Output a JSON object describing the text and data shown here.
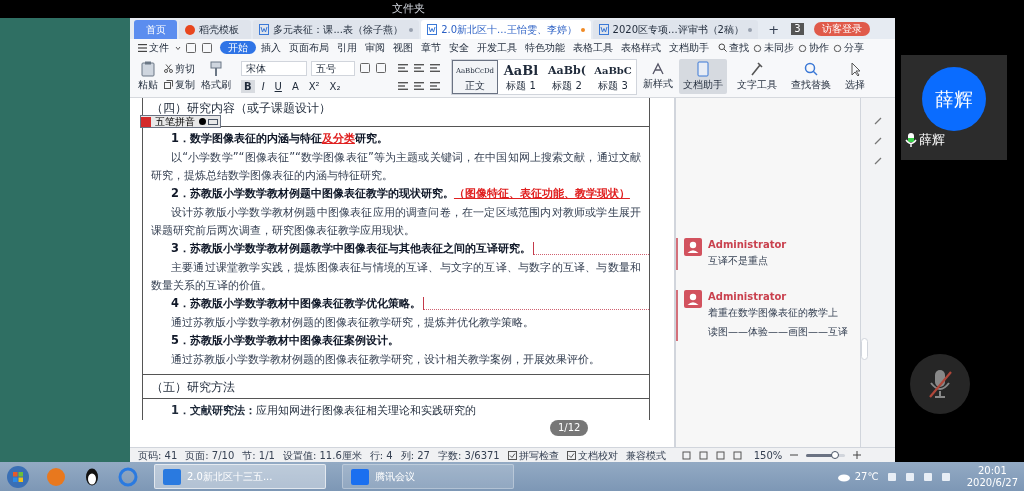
{
  "screen_title": "文件夹",
  "tabs": [
    {
      "label": "首页",
      "kind": "home",
      "selected": false
    },
    {
      "label": "稻壳模板",
      "kind": "template",
      "selected": false
    },
    {
      "label": "多元表征：课...表（徐子燕）",
      "kind": "doc",
      "selected": false
    },
    {
      "label": "2.0新北区十...王怡雯、李婷）",
      "kind": "doc",
      "selected": true
    },
    {
      "label": "2020区专项...评审书（2稿）",
      "kind": "doc",
      "selected": false
    }
  ],
  "tab_add": "+",
  "window_count": "3",
  "login_button": "访客登录",
  "menu": {
    "file": "文件",
    "items": [
      {
        "label": "开始",
        "selected": true
      },
      {
        "label": "插入",
        "selected": false
      },
      {
        "label": "页面布局",
        "selected": false
      },
      {
        "label": "引用",
        "selected": false
      },
      {
        "label": "审阅",
        "selected": false
      },
      {
        "label": "视图",
        "selected": false
      },
      {
        "label": "章节",
        "selected": false
      },
      {
        "label": "安全",
        "selected": false
      },
      {
        "label": "开发工具",
        "selected": false
      },
      {
        "label": "特色功能",
        "selected": false
      },
      {
        "label": "表格工具",
        "selected": false
      },
      {
        "label": "表格样式",
        "selected": false
      },
      {
        "label": "文档助手",
        "selected": false
      }
    ],
    "search": "查找",
    "right": [
      "未同步",
      "协作",
      "分享"
    ]
  },
  "ribbon": {
    "paste": "粘贴",
    "cut": "剪切",
    "copy": "复制",
    "format_painter": "格式刷",
    "font": "宋体",
    "size": "五号",
    "format_buttons": [
      "B",
      "I",
      "U",
      "A",
      "X²",
      "X₂"
    ],
    "styles": [
      {
        "sample": "AaBbCcDd",
        "label": "正文",
        "kind": "body",
        "selected": true
      },
      {
        "sample": "AaBl",
        "label": "标题 1",
        "kind": "h1",
        "selected": false
      },
      {
        "sample": "AaBb(",
        "label": "标题 2",
        "kind": "h2",
        "selected": false
      },
      {
        "sample": "AaBbC",
        "label": "标题 3",
        "kind": "h3",
        "selected": false
      }
    ],
    "new_style": "新样式",
    "big_buttons": [
      {
        "label": "文档助手",
        "kind": "assistant",
        "selected": true
      },
      {
        "label": "文字工具",
        "kind": "tools",
        "selected": false
      },
      {
        "label": "查找替换",
        "kind": "find",
        "selected": false
      },
      {
        "label": "选择",
        "kind": "select",
        "selected": false
      }
    ]
  },
  "ime": {
    "label": "五笔拼音"
  },
  "document": [
    {
      "kind": "section",
      "text": "（四）研究内容（或子课题设计）"
    },
    {
      "kind": "heading",
      "parts": [
        {
          "text": "1．数学图像表征的内涵与特征",
          "inserted": false
        },
        {
          "text": "及分类",
          "inserted": true
        },
        {
          "text": "研究。",
          "inserted": false
        }
      ],
      "comment": false
    },
    {
      "kind": "para",
      "text": "以“小学数学”“图像表征”“数学图像表征”等为主题或关键词，在中国知网上搜索文献，通过文献研究，提炼总结数学图像表征的内涵与特征研究。"
    },
    {
      "kind": "heading",
      "parts": [
        {
          "text": "2．苏教版小学数学教材例题中图像表征教学的现状研究。",
          "inserted": false
        },
        {
          "text": "（图像特征、表征功能、教学现状）",
          "inserted": true
        }
      ],
      "comment": false
    },
    {
      "kind": "para",
      "text": "设计苏教版小学数学教材例题中图像表征应用的调查问卷，在一定区域范围内对教师或学生展开课题研究前后两次调查，研究图像表征教学应用现状。"
    },
    {
      "kind": "heading",
      "parts": [
        {
          "text": "3．苏教版小学数学教材例题教学中图像表征与其他表征之间的互译研究。",
          "inserted": false
        }
      ],
      "comment": true
    },
    {
      "kind": "para",
      "text": "主要通过课堂教学实践，提炼图像表征与情境的互译、与文字的互译、与数字的互译、与数量和数量关系的互译的价值。"
    },
    {
      "kind": "heading",
      "parts": [
        {
          "text": "4．苏教版小学数学教材中图像表征教学优化策略。",
          "inserted": false
        }
      ],
      "comment": true
    },
    {
      "kind": "para",
      "text": "通过苏教版小学数学教材例题的图像表征教学研究，提炼并优化教学策略。"
    },
    {
      "kind": "heading",
      "parts": [
        {
          "text": "5．苏教版小学数学教材中图像表征案例设计。",
          "inserted": false
        }
      ],
      "comment": false
    },
    {
      "kind": "para",
      "text": "通过苏教版小学数学教材例题的图像表征教学研究，设计相关教学案例，开展效果评价。"
    },
    {
      "kind": "section",
      "text": "（五）研究方法"
    },
    {
      "kind": "cut",
      "text": "**1．文献研究法：**应用知网进行图像表征相关理论和实践研究的"
    }
  ],
  "comments": [
    {
      "author": "Administrator",
      "lines": [
        "互译不是重点"
      ]
    },
    {
      "author": "Administrator",
      "lines": [
        "着重在数学图像表征的教学上",
        "读图——体验——画图——互译"
      ]
    }
  ],
  "status_bar": {
    "items": [
      "页码: 41",
      "页面: 7/10",
      "节: 1/1",
      "设置值: 11.6厘米",
      "行: 4",
      "列: 27",
      "字数: 3/6371"
    ],
    "buttons": [
      "拼写检查",
      "文档校对"
    ],
    "mode": "兼容模式",
    "zoom": "150%",
    "zoom_level": {
      "level": 0.75
    }
  },
  "page_badge": "1/12",
  "taskbar": {
    "apps": [
      {
        "label": "2.0新北区十三五...",
        "kind": "wps",
        "selected": true
      },
      {
        "label": "腾讯会议",
        "kind": "meeting",
        "selected": false
      }
    ],
    "weather": "27℃",
    "time": "20:01",
    "date": "2020/6/27"
  },
  "meeting": {
    "avatar_text": "薛辉",
    "name": "薛辉",
    "mic_muted": true
  }
}
